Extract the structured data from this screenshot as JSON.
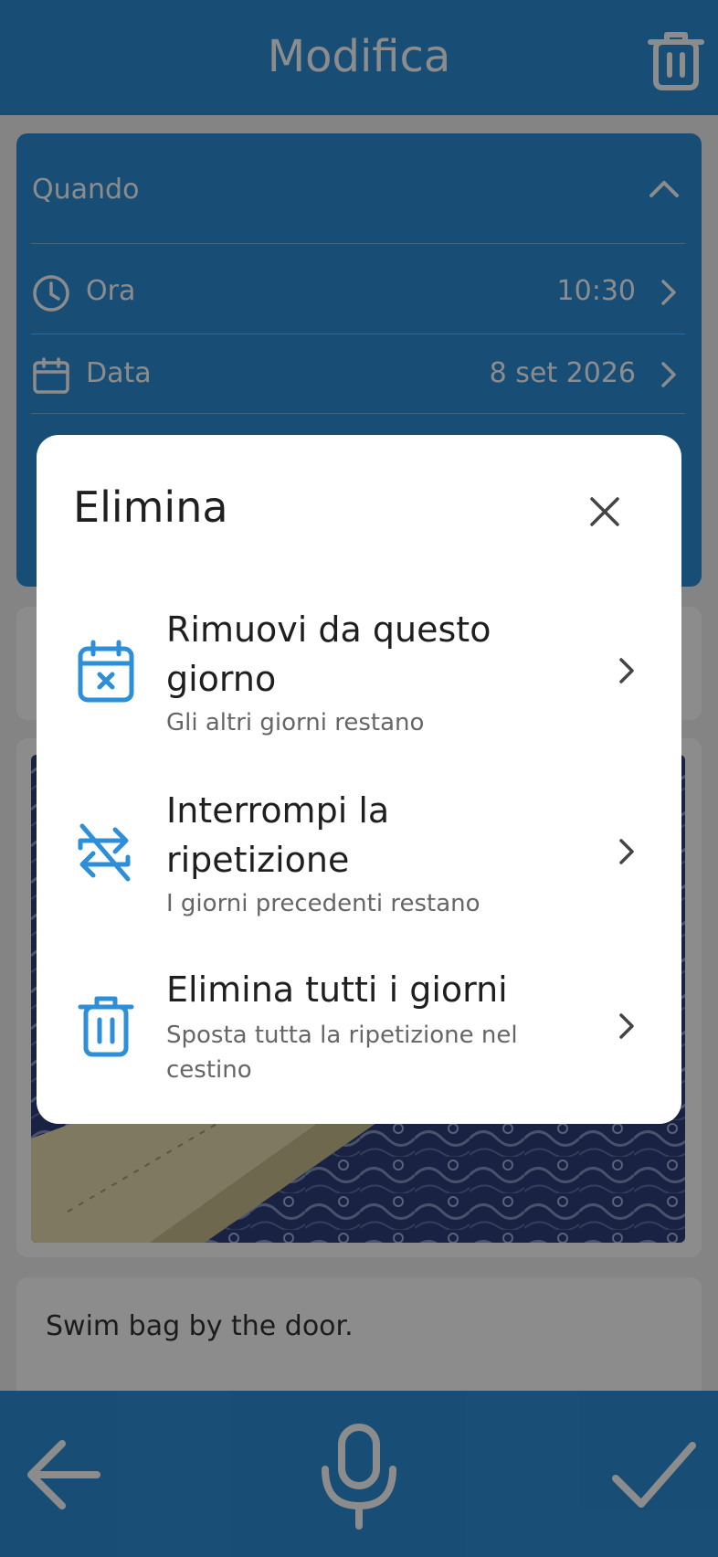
{
  "header": {
    "title": "Modifica",
    "trash_icon": "trash-icon"
  },
  "when_card": {
    "label": "Quando",
    "rows": [
      {
        "icon": "clock-icon",
        "label": "Ora",
        "value": "10:30"
      },
      {
        "icon": "calendar-icon",
        "label": "Data",
        "value": "8 set 2026"
      }
    ]
  },
  "note": {
    "text": "Swim bag by the door."
  },
  "bottom_bar": {
    "back_icon": "arrow-left-icon",
    "mic_icon": "microphone-icon",
    "check_icon": "check-icon"
  },
  "dialog": {
    "title": "Elimina",
    "options": [
      {
        "icon": "calendar-remove-icon",
        "title": "Rimuovi da questo giorno",
        "subtitle": "Gli altri giorni restano"
      },
      {
        "icon": "repeat-off-icon",
        "title": "Interrompi la ripetizione",
        "subtitle": "I giorni precedenti restano"
      },
      {
        "icon": "trash-icon",
        "title": "Elimina tutti i giorni",
        "subtitle": "Sposta tutta la ripetizione nel cestino"
      }
    ]
  },
  "colors": {
    "primary": "#2d8fd8",
    "dialog_icon": "#2d8fd8",
    "text_dark": "#1f1f1f",
    "text_muted": "#666666"
  }
}
